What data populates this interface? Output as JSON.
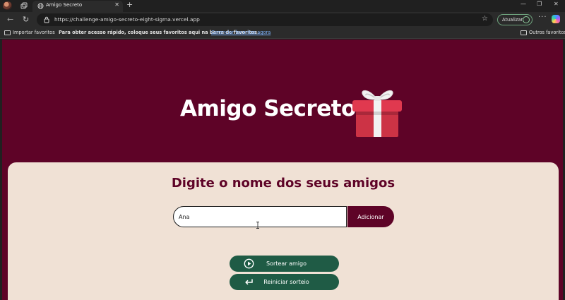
{
  "browser": {
    "tab": {
      "title": "Amigo Secreto"
    },
    "address_bar": {
      "url": "https://challenge-amigo-secreto-eight-sigma.vercel.app"
    },
    "update_button": {
      "label": "Atualizar"
    },
    "favorites_bar": {
      "import_label": "Importar favoritos",
      "message": "Para obter acesso rápido, coloque seus favoritos aqui na barra de favoritos.",
      "manage_link": "Gerenciar favoritos agora",
      "other_favorites": "Outros favoritos"
    }
  },
  "page": {
    "title": "Amigo Secreto",
    "subtitle": "Digite o nome dos seus amigos",
    "name_input": {
      "value": "Ana"
    },
    "add_button": "Adicionar",
    "draw_button": "Sortear amigo",
    "reset_button": "Reiniciar sorteio"
  },
  "colors": {
    "primary": "#5e0327",
    "card_background": "#f0e1d5",
    "action_button": "#1f5b45"
  }
}
